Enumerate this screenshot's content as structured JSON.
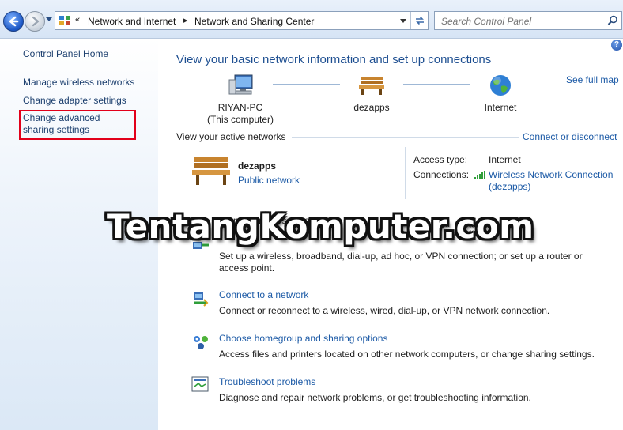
{
  "address_bar": {
    "breadcrumb_overflow": "«",
    "crumbs": [
      "Network and Internet",
      "Network and Sharing Center"
    ],
    "separator": "▸"
  },
  "search": {
    "placeholder": "Search Control Panel"
  },
  "sidebar": {
    "home": "Control Panel Home",
    "items": [
      {
        "label": "Manage wireless networks"
      },
      {
        "label": "Change adapter settings"
      },
      {
        "label": "Change advanced sharing settings",
        "highlighted": true,
        "highlight_color": "#e2001a"
      }
    ]
  },
  "main": {
    "help_label": "?",
    "heading": "View your basic network information and set up connections",
    "see_full_map": "See full map",
    "map": {
      "computer_name": "RIYAN-PC",
      "computer_sub": "(This computer)",
      "network_name": "dezapps",
      "internet": "Internet"
    },
    "active_networks": {
      "title": "View your active networks",
      "connect_link": "Connect or disconnect",
      "network_name": "dezapps",
      "network_type": "Public network",
      "access_type_label": "Access type:",
      "access_type_value": "Internet",
      "connections_label": "Connections:",
      "connection_name_line1": "Wireless Network Connection",
      "connection_name_line2": "(dezapps)"
    },
    "change_settings": {
      "title": "Change your networking settings",
      "tasks": [
        {
          "title": "",
          "desc": "Set up a wireless, broadband, dial-up, ad hoc, or VPN connection; or set up a router or access point.",
          "icon": "setup-connection-icon"
        },
        {
          "title": "Connect to a network",
          "desc": "Connect or reconnect to a wireless, wired, dial-up, or VPN network connection.",
          "icon": "connect-network-icon"
        },
        {
          "title": "Choose homegroup and sharing options",
          "desc": "Access files and printers located on other network computers, or change sharing settings.",
          "icon": "homegroup-icon"
        },
        {
          "title": "Troubleshoot problems",
          "desc": "Diagnose and repair network problems, or get troubleshooting information.",
          "icon": "troubleshoot-icon"
        }
      ]
    }
  },
  "watermark": "TentangKomputer.com",
  "colors": {
    "link": "#1c5aa6",
    "heading": "#1e4f91",
    "highlight_box": "#e2001a"
  }
}
